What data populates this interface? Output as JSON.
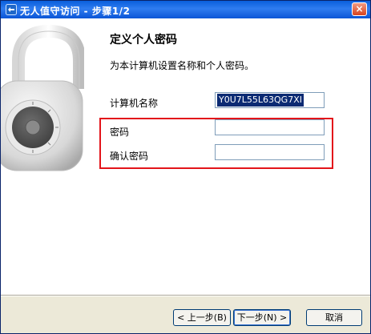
{
  "window": {
    "title": "无人值守访问 - 步骤1/2",
    "close_glyph": "×"
  },
  "page": {
    "heading": "定义个人密码",
    "description": "为本计算机设置名称和个人密码。"
  },
  "form": {
    "computer_name": {
      "label": "计算机名称",
      "value": "Y0U7L55L63QG7XI"
    },
    "password": {
      "label": "密码",
      "value": ""
    },
    "confirm_password": {
      "label": "确认密码",
      "value": ""
    }
  },
  "buttons": {
    "back": "< 上一步(B)",
    "next": "下一步(N) >",
    "cancel": "取消"
  },
  "colors": {
    "titlebar": "#0a5fdc",
    "highlight_box": "#e3141a",
    "selection": "#0b2a73"
  },
  "icons": {
    "title": "app-icon",
    "art": "padlock-icon"
  }
}
